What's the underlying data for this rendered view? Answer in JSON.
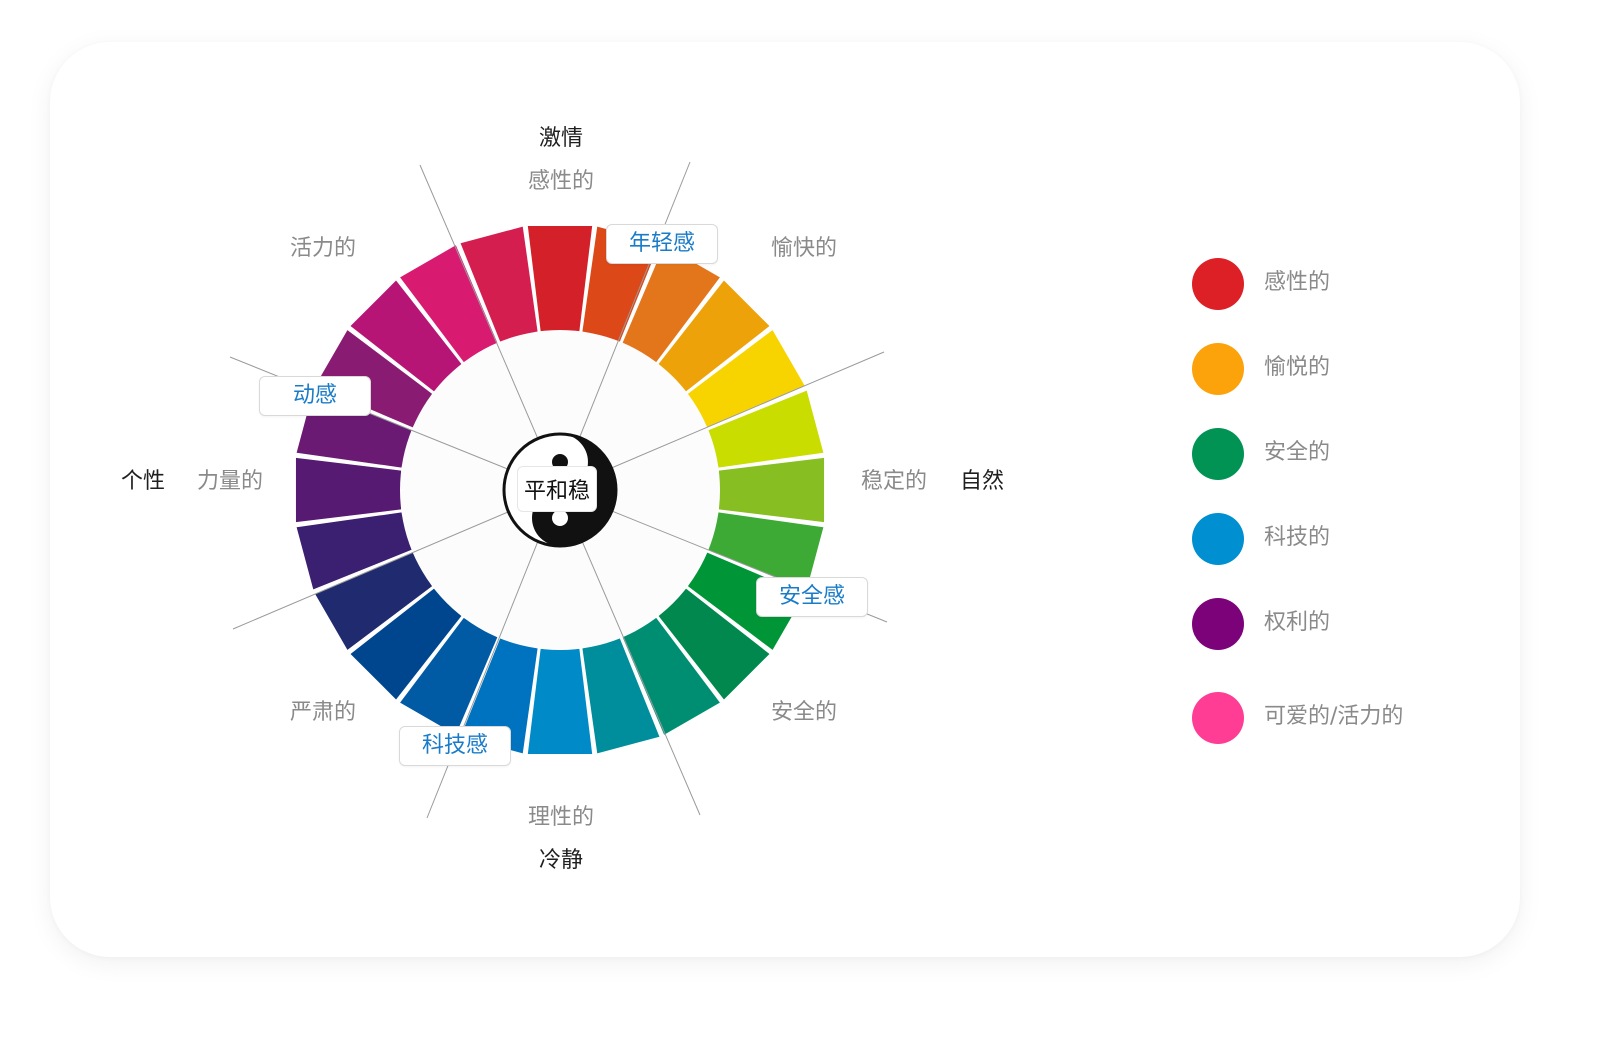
{
  "wheel": {
    "segment_colors": [
      "#d32029",
      "#dc4818",
      "#e3761a",
      "#eea20a",
      "#f7d400",
      "#c9dd00",
      "#87be22",
      "#3daa35",
      "#009638",
      "#00884f",
      "#008e73",
      "#008e9c",
      "#008ac7",
      "#0073c0",
      "#005aa4",
      "#00468e",
      "#1f2a6f",
      "#3b1f70",
      "#561a73",
      "#6b1a73",
      "#8a1b73",
      "#b61576",
      "#d81a71",
      "#d51e50"
    ],
    "center_label": "平和稳"
  },
  "axes": {
    "top": "激情",
    "bottom": "冷静",
    "left": "个性",
    "right": "自然"
  },
  "moods": {
    "top": "感性的",
    "top_right": "愉快的",
    "right": "稳定的",
    "bottom_right": "安全的",
    "bottom": "理性的",
    "bottom_left": "严肃的",
    "left": "力量的",
    "top_left": "活力的"
  },
  "tags": {
    "young": "年轻感",
    "dynamic": "动感",
    "safety": "安全感",
    "tech": "科技感"
  },
  "legend": [
    {
      "label": "感性的",
      "color": "#dd1f26"
    },
    {
      "label": "愉悦的",
      "color": "#fca20a"
    },
    {
      "label": "安全的",
      "color": "#009354"
    },
    {
      "label": "科技的",
      "color": "#008fd0"
    },
    {
      "label": "权利的",
      "color": "#7c0279"
    },
    {
      "label": "可爱的/活力的",
      "color": "#ff3d95"
    }
  ]
}
